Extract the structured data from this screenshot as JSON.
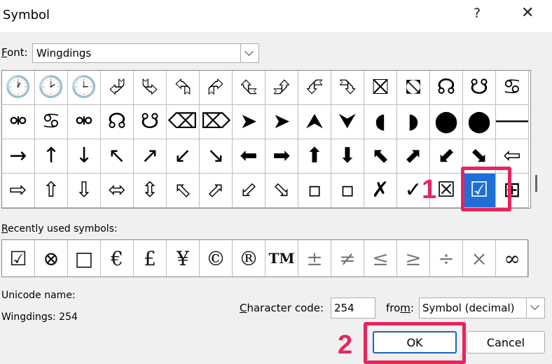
{
  "window": {
    "title": "Symbol",
    "help_glyph": "?",
    "close_glyph": "✕"
  },
  "font": {
    "label_prefix": "",
    "label_underlined": "F",
    "label_rest": "ont:",
    "value": "Wingdings"
  },
  "symbol_grid": {
    "rows": [
      [
        "🕐",
        "🕑",
        "🕒",
        "⮰",
        "⮱",
        "⮲",
        "⮳",
        "⮴",
        "⮵",
        "⮶",
        "⮷",
        "⛝",
        "⛞",
        "☊",
        "☋",
        "♋"
      ],
      [
        "⚮",
        "♋",
        "⚮",
        "☊",
        "☋",
        "⌫",
        "⌦",
        "➤",
        "➤",
        "⮝",
        "⮟",
        "◖",
        "◗",
        "⬤",
        "⬤",
        "🡐"
      ],
      [
        "→",
        "↑",
        "↓",
        "↖",
        "↗",
        "↙",
        "↘",
        "⬅",
        "➡",
        "⬆",
        "⬇",
        "⬉",
        "⬈",
        "⬋",
        "⬊",
        "⇦"
      ],
      [
        "⇨",
        "⇧",
        "⇩",
        "⬄",
        "⇳",
        "⬁",
        "⬀",
        "⬃",
        "⬂",
        "▫",
        "▫",
        "✗",
        "✓",
        "☒",
        "☑",
        "⊞"
      ]
    ],
    "selected_glyph": "☑"
  },
  "recent": {
    "label_underlined": "R",
    "label_rest": "ecently used symbols:",
    "symbols": [
      "☑",
      "⊗",
      "□",
      "€",
      "£",
      "¥",
      "©",
      "®",
      "TM",
      "±",
      "≠",
      "≤",
      "≥",
      "÷",
      "×",
      "∞"
    ]
  },
  "unicode": {
    "label": "Unicode name:",
    "value": "Wingdings: 254"
  },
  "char_code": {
    "label_underlined": "C",
    "label_rest": "haracter code:",
    "value": "254"
  },
  "from": {
    "label_prefix": "fro",
    "label_underlined": "m",
    "label_rest": ":",
    "value": "Symbol (decimal)"
  },
  "buttons": {
    "ok": "OK",
    "cancel": "Cancel"
  },
  "steps": {
    "one": "1",
    "two": "2"
  },
  "colors": {
    "highlight": "#e7245e",
    "selection": "#1f6fd6"
  }
}
